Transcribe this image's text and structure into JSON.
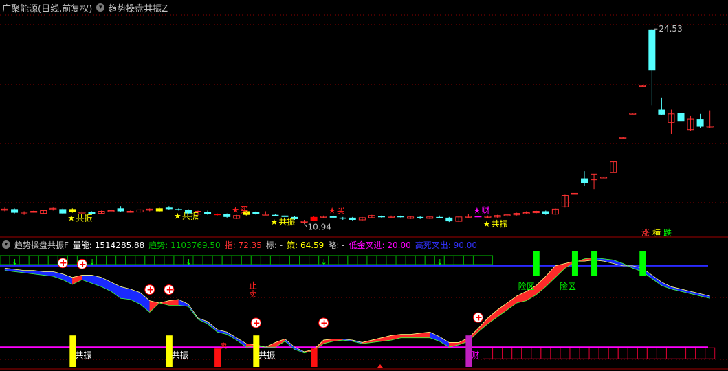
{
  "main": {
    "title": "广聚能源(日线,前复权)",
    "indicator_name": "趋势操盘共振Z",
    "menu_icon": "chevron-down-circle-icon",
    "price_high_label": "24.53",
    "price_low_label": "10.94",
    "legend": [
      "涨",
      "横",
      "跌"
    ],
    "legend_colors": [
      "#ff3232",
      "#ffff00",
      "#00ff00"
    ],
    "signal_labels": {
      "resonance": "共振",
      "buy": "买",
      "wealth": "财"
    },
    "colors": {
      "up": "#ff3232",
      "down": "#54ffff",
      "yellow": "#ffff00",
      "magenta": "#ff00ff",
      "grid": "#8b0000",
      "bg": "#000000"
    }
  },
  "sub": {
    "indicator_name": "趋势操盘共振F",
    "values": [
      {
        "label": "量能:",
        "value": "1514285.88",
        "color": "#ffffff"
      },
      {
        "label": "趋势:",
        "value": "1103769.50",
        "color": "#00c000"
      },
      {
        "label": "指:",
        "value": "72.35",
        "color": "#ff3232"
      },
      {
        "label": "标:",
        "value": "-",
        "color": "#c0c0c0"
      },
      {
        "label": "策:",
        "value": "64.59",
        "color": "#ffff00"
      },
      {
        "label": "略:",
        "value": "-",
        "color": "#c0c0c0"
      },
      {
        "label": "低金叉进:",
        "value": "20.00",
        "color": "#ff00ff"
      },
      {
        "label": "高死叉出:",
        "value": "90.00",
        "color": "#3232ff"
      }
    ],
    "labels": {
      "risk": "险区",
      "stop_sell": "止卖",
      "resonance": "共振",
      "wealth": "财",
      "sell": "卖"
    },
    "upper_line_color": "#2a2aff",
    "lower_line_color": "#ff00ff"
  },
  "chart_data": [
    {
      "type": "candlestick",
      "title": "广聚能源(日线,前复权)",
      "annotations": [
        {
          "text": "24.53",
          "kind": "high"
        },
        {
          "text": "10.94",
          "kind": "low"
        }
      ],
      "candles": [
        {
          "o": 11.9,
          "h": 12.05,
          "l": 11.8,
          "c": 11.95
        },
        {
          "o": 11.95,
          "h": 12.0,
          "l": 11.65,
          "c": 11.7
        },
        {
          "o": 11.7,
          "h": 11.8,
          "l": 11.55,
          "c": 11.75
        },
        {
          "o": 11.75,
          "h": 11.85,
          "l": 11.7,
          "c": 11.8
        },
        {
          "o": 11.65,
          "h": 11.9,
          "l": 11.6,
          "c": 11.85
        },
        {
          "o": 11.95,
          "h": 12.05,
          "l": 11.85,
          "c": 12.0
        },
        {
          "o": 11.95,
          "h": 12.0,
          "l": 11.6,
          "c": 11.65
        },
        {
          "o": 11.95,
          "h": 12.0,
          "l": 11.7,
          "c": 11.75,
          "hl": "yellow"
        },
        {
          "o": 11.7,
          "h": 11.85,
          "l": 11.6,
          "c": 11.75
        },
        {
          "o": 11.75,
          "h": 11.8,
          "l": 11.55,
          "c": 11.6
        },
        {
          "o": 11.65,
          "h": 11.85,
          "l": 11.6,
          "c": 11.8
        },
        {
          "o": 11.8,
          "h": 11.95,
          "l": 11.75,
          "c": 11.85
        },
        {
          "o": 12.0,
          "h": 12.15,
          "l": 11.75,
          "c": 11.8
        },
        {
          "o": 11.75,
          "h": 11.85,
          "l": 11.7,
          "c": 11.8
        },
        {
          "o": 11.75,
          "h": 11.95,
          "l": 11.7,
          "c": 11.9
        },
        {
          "o": 11.9,
          "h": 12.0,
          "l": 11.8,
          "c": 11.95
        },
        {
          "o": 12.0,
          "h": 12.05,
          "l": 11.75,
          "c": 11.8,
          "hl": "yellow"
        },
        {
          "o": 12.05,
          "h": 12.15,
          "l": 11.9,
          "c": 11.95
        },
        {
          "o": 11.95,
          "h": 12.0,
          "l": 11.85,
          "c": 11.9
        },
        {
          "o": 11.9,
          "h": 11.95,
          "l": 11.6,
          "c": 11.65
        },
        {
          "o": 11.6,
          "h": 11.85,
          "l": 11.55,
          "c": 11.8
        },
        {
          "o": 11.75,
          "h": 11.85,
          "l": 11.55,
          "c": 11.6
        },
        {
          "o": 11.6,
          "h": 11.65,
          "l": 11.5,
          "c": 11.55,
          "hl": "red"
        },
        {
          "o": 11.6,
          "h": 11.65,
          "l": 11.35,
          "c": 11.4
        },
        {
          "o": 11.3,
          "h": 11.55,
          "l": 11.25,
          "c": 11.5
        },
        {
          "o": 11.8,
          "h": 11.85,
          "l": 11.5,
          "c": 11.55,
          "hl": "yellow"
        },
        {
          "o": 11.75,
          "h": 11.8,
          "l": 11.55,
          "c": 11.6
        },
        {
          "o": 11.6,
          "h": 11.8,
          "l": 11.55,
          "c": 11.6
        },
        {
          "o": 11.55,
          "h": 11.6,
          "l": 11.45,
          "c": 11.5
        },
        {
          "o": 11.5,
          "h": 11.55,
          "l": 11.35,
          "c": 11.4
        },
        {
          "o": 11.4,
          "h": 11.45,
          "l": 11.2,
          "c": 11.25
        },
        {
          "o": 11.1,
          "h": 11.2,
          "l": 10.94,
          "c": 11.1
        },
        {
          "o": 11.15,
          "h": 11.45,
          "l": 11.1,
          "c": 11.4,
          "hl": "red"
        },
        {
          "o": 11.4,
          "h": 11.5,
          "l": 11.3,
          "c": 11.45
        },
        {
          "o": 11.45,
          "h": 11.5,
          "l": 11.3,
          "c": 11.35
        },
        {
          "o": 11.35,
          "h": 11.4,
          "l": 11.2,
          "c": 11.3
        },
        {
          "o": 11.35,
          "h": 11.4,
          "l": 11.15,
          "c": 11.2
        },
        {
          "o": 11.2,
          "h": 11.4,
          "l": 11.15,
          "c": 11.35
        },
        {
          "o": 11.35,
          "h": 11.55,
          "l": 11.3,
          "c": 11.5
        },
        {
          "o": 11.45,
          "h": 11.5,
          "l": 11.35,
          "c": 11.4
        },
        {
          "o": 11.45,
          "h": 11.5,
          "l": 11.35,
          "c": 11.45
        },
        {
          "o": 11.45,
          "h": 11.5,
          "l": 11.35,
          "c": 11.4
        },
        {
          "o": 11.3,
          "h": 11.45,
          "l": 11.25,
          "c": 11.4
        },
        {
          "o": 11.4,
          "h": 11.45,
          "l": 11.25,
          "c": 11.3
        },
        {
          "o": 11.3,
          "h": 11.45,
          "l": 11.25,
          "c": 11.4
        },
        {
          "o": 11.4,
          "h": 11.5,
          "l": 11.3,
          "c": 11.3
        },
        {
          "o": 11.35,
          "h": 11.4,
          "l": 11.05,
          "c": 11.1
        },
        {
          "o": 11.1,
          "h": 11.45,
          "l": 11.05,
          "c": 11.4
        },
        {
          "o": 11.4,
          "h": 11.6,
          "l": 11.35,
          "c": 11.45
        },
        {
          "o": 11.45,
          "h": 11.5,
          "l": 11.35,
          "c": 11.4,
          "hl": "magenta"
        },
        {
          "o": 11.4,
          "h": 11.5,
          "l": 11.3,
          "c": 11.45
        },
        {
          "o": 11.4,
          "h": 11.55,
          "l": 11.35,
          "c": 11.5
        },
        {
          "o": 11.5,
          "h": 11.6,
          "l": 11.4,
          "c": 11.55
        },
        {
          "o": 11.55,
          "h": 11.7,
          "l": 11.5,
          "c": 11.65
        },
        {
          "o": 11.65,
          "h": 11.8,
          "l": 11.6,
          "c": 11.7
        },
        {
          "o": 11.7,
          "h": 11.85,
          "l": 11.6,
          "c": 11.8
        },
        {
          "o": 11.8,
          "h": 11.85,
          "l": 11.55,
          "c": 11.6
        },
        {
          "o": 11.6,
          "h": 12.0,
          "l": 11.55,
          "c": 11.95
        },
        {
          "o": 12.1,
          "h": 12.95,
          "l": 12.05,
          "c": 12.9
        },
        {
          "o": 13.0,
          "h": 13.05,
          "l": 13.0,
          "c": 13.05
        },
        {
          "o": 14.1,
          "h": 14.6,
          "l": 13.6,
          "c": 13.75
        },
        {
          "o": 14.0,
          "h": 14.4,
          "l": 13.35,
          "c": 14.4
        },
        {
          "o": 14.15,
          "h": 14.2,
          "l": 14.15,
          "c": 14.2
        },
        {
          "o": 14.5,
          "h": 15.25,
          "l": 14.5,
          "c": 15.25
        },
        {
          "o": 16.9,
          "h": 16.95,
          "l": 16.9,
          "c": 16.95
        },
        {
          "o": 18.6,
          "h": 18.65,
          "l": 18.6,
          "c": 18.65
        },
        {
          "o": 20.55,
          "h": 20.6,
          "l": 20.55,
          "c": 20.6
        },
        {
          "o": 24.5,
          "h": 24.53,
          "l": 19.2,
          "c": 21.65
        },
        {
          "o": 18.9,
          "h": 19.75,
          "l": 18.5,
          "c": 18.55
        },
        {
          "o": 18.0,
          "h": 18.9,
          "l": 17.2,
          "c": 18.6
        },
        {
          "o": 18.65,
          "h": 18.85,
          "l": 17.75,
          "c": 18.1
        },
        {
          "o": 17.5,
          "h": 18.45,
          "l": 17.4,
          "c": 18.25
        },
        {
          "o": 18.25,
          "h": 18.6,
          "l": 17.6,
          "c": 17.7
        },
        {
          "o": 17.7,
          "h": 18.85,
          "l": 17.6,
          "c": 17.75
        }
      ],
      "ylim": [
        10.0,
        25.5
      ]
    },
    {
      "type": "area",
      "title": "趋势操盘共振F",
      "scale": [
        0,
        100
      ],
      "upper_line": 90,
      "lower_line": 20,
      "band_upper": [
        88,
        87,
        86,
        86,
        85,
        85,
        83,
        80,
        82,
        82,
        80,
        76,
        72,
        70,
        67,
        60,
        58,
        60,
        61,
        57,
        45,
        42,
        35,
        33,
        28,
        23,
        22,
        20,
        24,
        27,
        20,
        16,
        18,
        26,
        27,
        27,
        26,
        24,
        26,
        28,
        30,
        31,
        31,
        32,
        33,
        29,
        24,
        24,
        28,
        36,
        45,
        52,
        58,
        64,
        68,
        73,
        81,
        90,
        92,
        94,
        94,
        95,
        94,
        92,
        90,
        90,
        88,
        82,
        76,
        72,
        70,
        68,
        66,
        64
      ],
      "band_lower": [
        86,
        85,
        84,
        83,
        82,
        81,
        78,
        74,
        78,
        75,
        72,
        68,
        62,
        61,
        57,
        50,
        58,
        56,
        56,
        55,
        44,
        40,
        33,
        31,
        26,
        20,
        21,
        20,
        20,
        25,
        18,
        15,
        17,
        23,
        25,
        26,
        25,
        23,
        24,
        25,
        26,
        28,
        28,
        28,
        28,
        25,
        20,
        22,
        25,
        33,
        40,
        46,
        52,
        58,
        60,
        65,
        72,
        80,
        88,
        93,
        96,
        97,
        96,
        95,
        92,
        88,
        85,
        79,
        73,
        70,
        68,
        66,
        64,
        62
      ],
      "markers": [
        {
          "bar": 6,
          "type": "plus"
        },
        {
          "bar": 8,
          "type": "plus"
        },
        {
          "bar": 15,
          "type": "plus"
        },
        {
          "bar": 17,
          "type": "plus"
        },
        {
          "bar": 26,
          "type": "plus"
        },
        {
          "bar": 33,
          "type": "plus"
        },
        {
          "bar": 49,
          "type": "plus"
        },
        {
          "bar": 7,
          "type": "bar",
          "color": "yellow",
          "text": "共振"
        },
        {
          "bar": 17,
          "type": "bar",
          "color": "yellow",
          "text": "共振"
        },
        {
          "bar": 26,
          "type": "bar",
          "color": "yellow",
          "text": "共振"
        },
        {
          "bar": 22,
          "type": "bar",
          "color": "red"
        },
        {
          "bar": 32,
          "type": "bar",
          "color": "red"
        },
        {
          "bar": 48,
          "type": "bar",
          "color": "magenta",
          "text": "财"
        }
      ]
    }
  ]
}
